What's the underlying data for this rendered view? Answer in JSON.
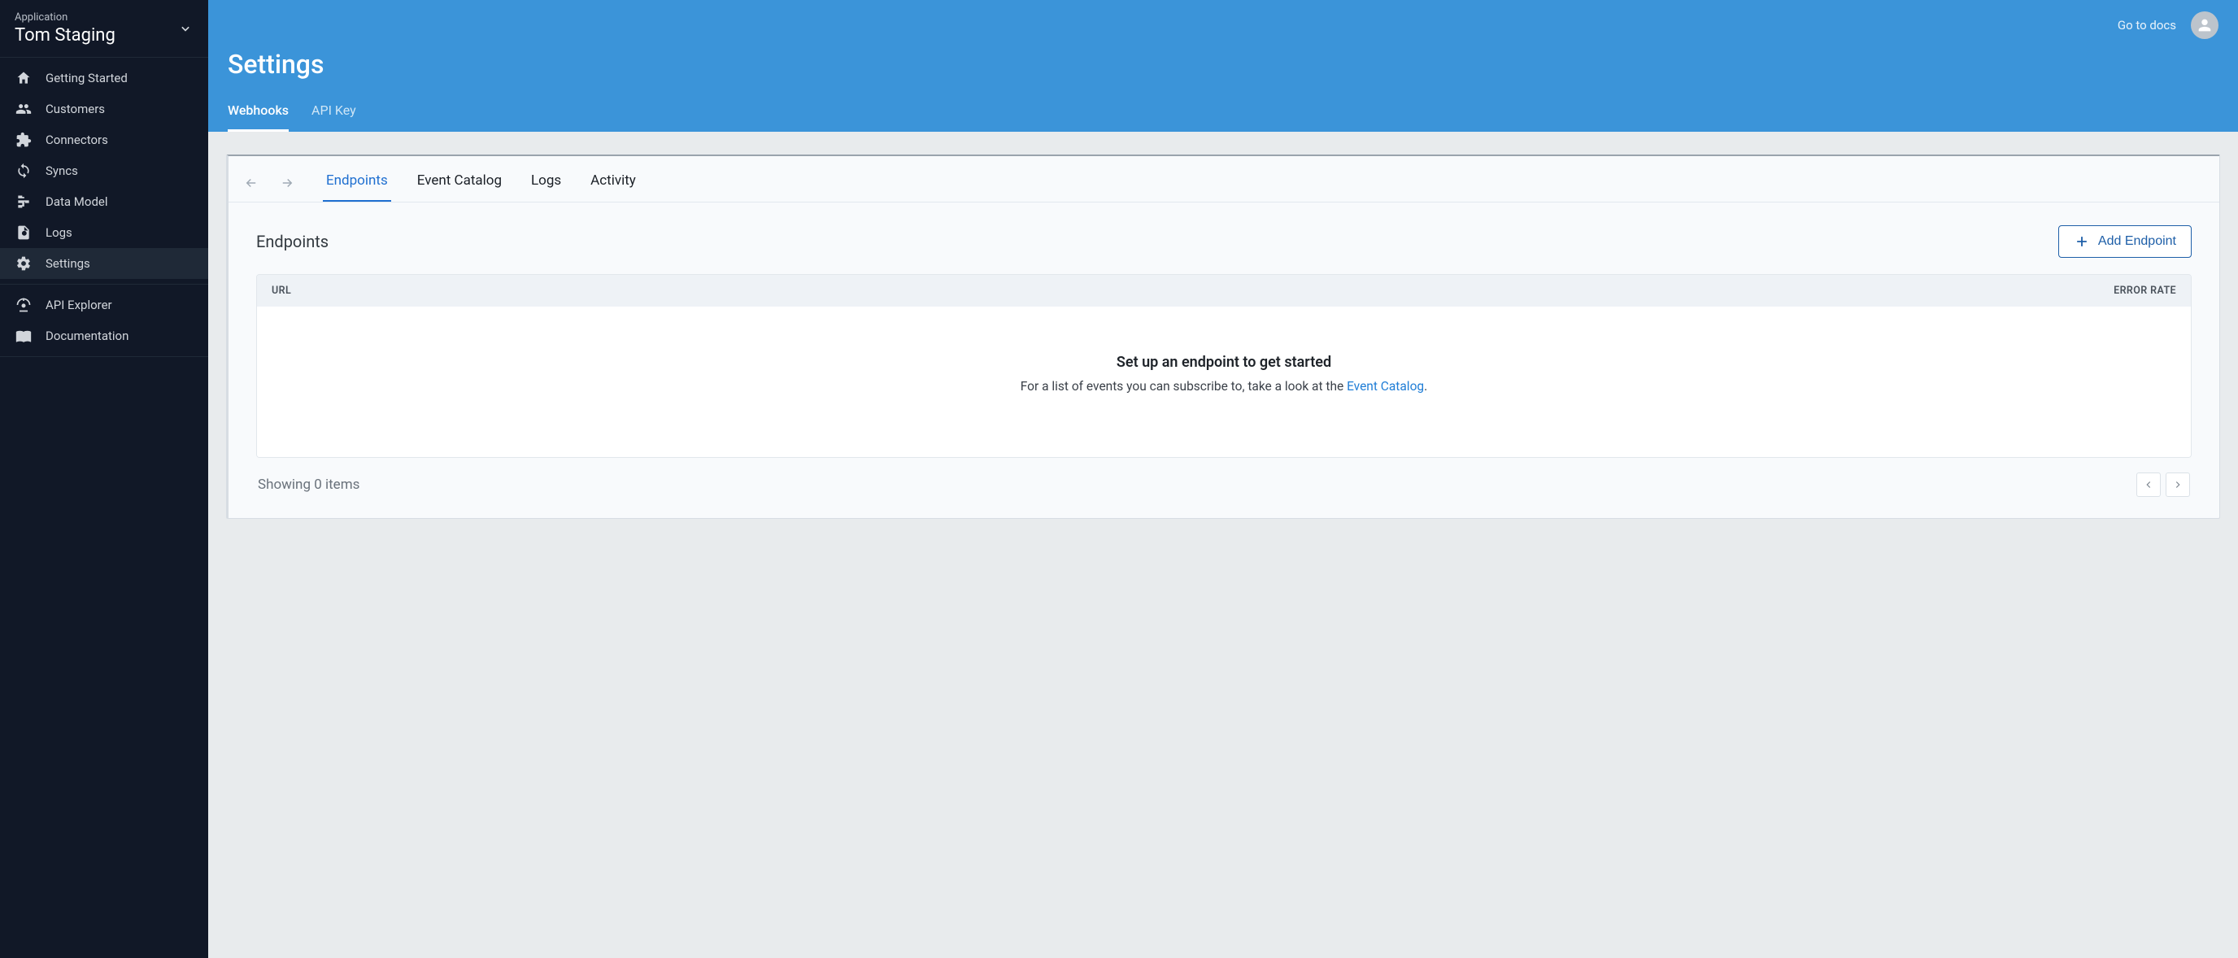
{
  "sidebar": {
    "label": "Application",
    "appName": "Tom Staging",
    "navA": [
      {
        "label": "Getting Started"
      },
      {
        "label": "Customers"
      },
      {
        "label": "Connectors"
      },
      {
        "label": "Syncs"
      },
      {
        "label": "Data Model"
      },
      {
        "label": "Logs"
      },
      {
        "label": "Settings"
      }
    ],
    "navB": [
      {
        "label": "API Explorer"
      },
      {
        "label": "Documentation"
      }
    ]
  },
  "header": {
    "docsLink": "Go to docs",
    "title": "Settings",
    "tabs": [
      {
        "label": "Webhooks",
        "active": true
      },
      {
        "label": "API Key",
        "active": false
      }
    ]
  },
  "panel": {
    "tabs": [
      {
        "label": "Endpoints",
        "active": true
      },
      {
        "label": "Event Catalog",
        "active": false
      },
      {
        "label": "Logs",
        "active": false
      },
      {
        "label": "Activity",
        "active": false
      }
    ],
    "sectionTitle": "Endpoints",
    "addButton": "Add Endpoint",
    "columns": {
      "url": "URL",
      "errorRate": "ERROR RATE"
    },
    "empty": {
      "title": "Set up an endpoint to get started",
      "prefix": "For a list of events you can subscribe to, take a look at the ",
      "link": "Event Catalog",
      "suffix": "."
    },
    "footer": {
      "showing": "Showing 0 items"
    }
  }
}
